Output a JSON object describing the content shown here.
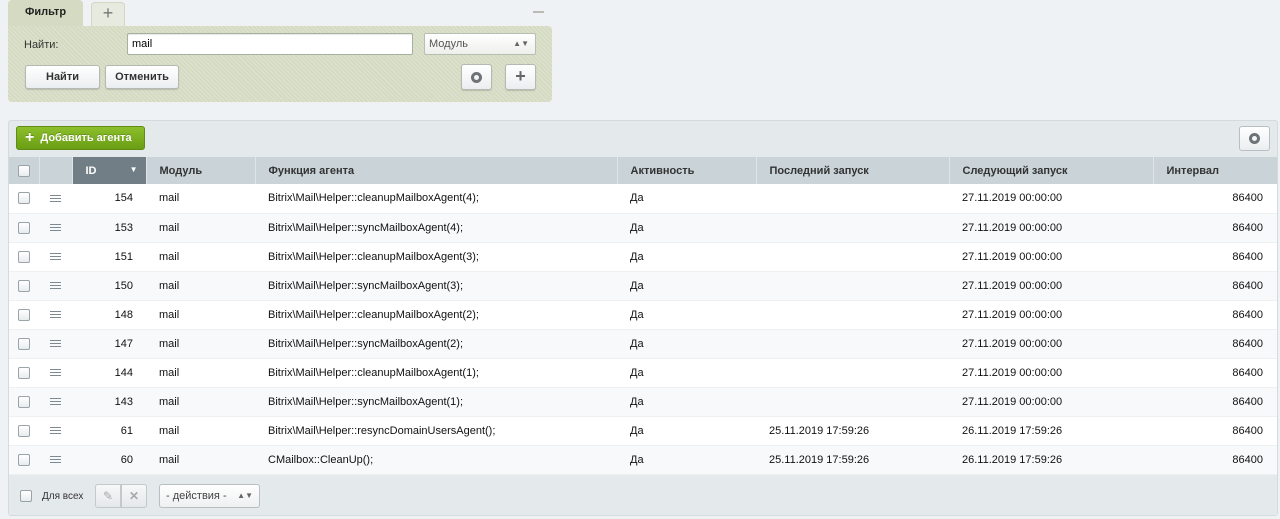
{
  "filter": {
    "tab_label": "Фильтр",
    "tab_add_label": "+",
    "find_label": "Найти:",
    "find_value": "mail",
    "module_select_value": "Модуль",
    "find_button": "Найти",
    "cancel_button": "Отменить",
    "add_button": "+"
  },
  "toolbar": {
    "add_agent_button": "Добавить агента"
  },
  "grid": {
    "columns": {
      "id": "ID",
      "module": "Модуль",
      "function": "Функция агента",
      "active": "Активность",
      "last_run": "Последний запуск",
      "next_run": "Следующий запуск",
      "interval": "Интервал"
    },
    "rows": [
      {
        "id": "154",
        "module": "mail",
        "function": "Bitrix\\Mail\\Helper::cleanupMailboxAgent(4);",
        "active": "Да",
        "last_run": "",
        "next_run": "27.11.2019 00:00:00",
        "interval": "86400"
      },
      {
        "id": "153",
        "module": "mail",
        "function": "Bitrix\\Mail\\Helper::syncMailboxAgent(4);",
        "active": "Да",
        "last_run": "",
        "next_run": "27.11.2019 00:00:00",
        "interval": "86400"
      },
      {
        "id": "151",
        "module": "mail",
        "function": "Bitrix\\Mail\\Helper::cleanupMailboxAgent(3);",
        "active": "Да",
        "last_run": "",
        "next_run": "27.11.2019 00:00:00",
        "interval": "86400"
      },
      {
        "id": "150",
        "module": "mail",
        "function": "Bitrix\\Mail\\Helper::syncMailboxAgent(3);",
        "active": "Да",
        "last_run": "",
        "next_run": "27.11.2019 00:00:00",
        "interval": "86400"
      },
      {
        "id": "148",
        "module": "mail",
        "function": "Bitrix\\Mail\\Helper::cleanupMailboxAgent(2);",
        "active": "Да",
        "last_run": "",
        "next_run": "27.11.2019 00:00:00",
        "interval": "86400"
      },
      {
        "id": "147",
        "module": "mail",
        "function": "Bitrix\\Mail\\Helper::syncMailboxAgent(2);",
        "active": "Да",
        "last_run": "",
        "next_run": "27.11.2019 00:00:00",
        "interval": "86400"
      },
      {
        "id": "144",
        "module": "mail",
        "function": "Bitrix\\Mail\\Helper::cleanupMailboxAgent(1);",
        "active": "Да",
        "last_run": "",
        "next_run": "27.11.2019 00:00:00",
        "interval": "86400"
      },
      {
        "id": "143",
        "module": "mail",
        "function": "Bitrix\\Mail\\Helper::syncMailboxAgent(1);",
        "active": "Да",
        "last_run": "",
        "next_run": "27.11.2019 00:00:00",
        "interval": "86400"
      },
      {
        "id": "61",
        "module": "mail",
        "function": "Bitrix\\Mail\\Helper::resyncDomainUsersAgent();",
        "active": "Да",
        "last_run": "25.11.2019 17:59:26",
        "next_run": "26.11.2019 17:59:26",
        "interval": "86400"
      },
      {
        "id": "60",
        "module": "mail",
        "function": "CMailbox::CleanUp();",
        "active": "Да",
        "last_run": "25.11.2019 17:59:26",
        "next_run": "26.11.2019 17:59:26",
        "interval": "86400"
      }
    ]
  },
  "footer": {
    "for_all_label": "Для всех",
    "actions_select_value": "- действия -"
  }
}
